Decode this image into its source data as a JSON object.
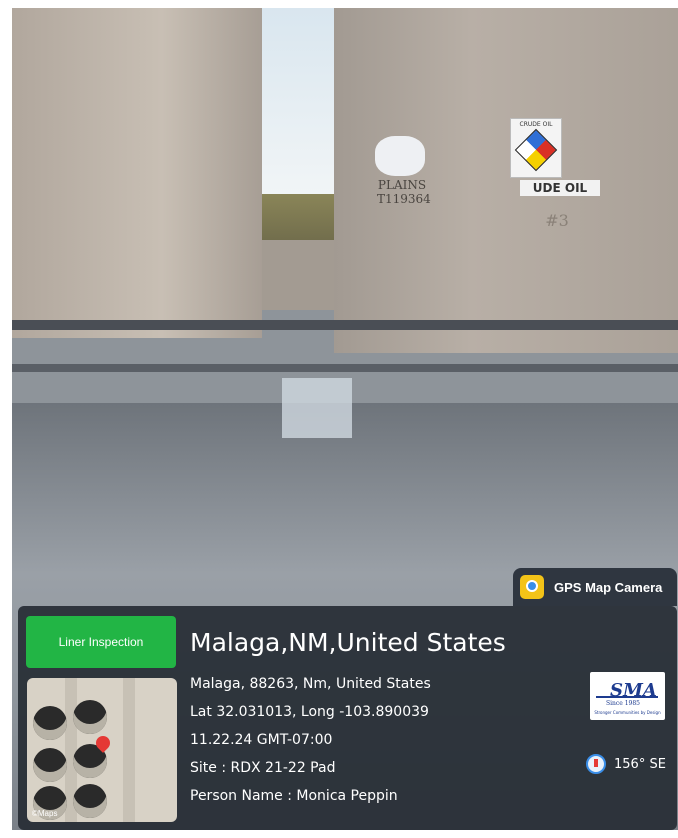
{
  "photo": {
    "tank_text_left": "PLAINS\nT119364",
    "tank_number": "#3",
    "hazmat_title": "CRUDE OIL",
    "crude_label": "UDE OIL"
  },
  "gps_tag": {
    "text": "GPS Map Camera",
    "icon": "gps-map-camera-logo"
  },
  "panel": {
    "tag_button": "Liner Inspection",
    "map_label": "©Maps",
    "title": "Malaga,NM,United States",
    "address_line": "Malaga, 88263, Nm, United States",
    "coordinates": "Lat 32.031013, Long -103.890039",
    "datetime": "11.22.24 GMT-07:00",
    "site": "Site : RDX 21-22 Pad",
    "person": "Person Name : Monica Peppin"
  },
  "sma_logo": {
    "word": "SMA",
    "since": "Since 1985",
    "tagline": "Stronger Communities by Design"
  },
  "compass": {
    "value": "156° SE",
    "icon": "compass-icon"
  },
  "colors": {
    "accent": "#22b545",
    "panel_bg": "#262c34"
  }
}
